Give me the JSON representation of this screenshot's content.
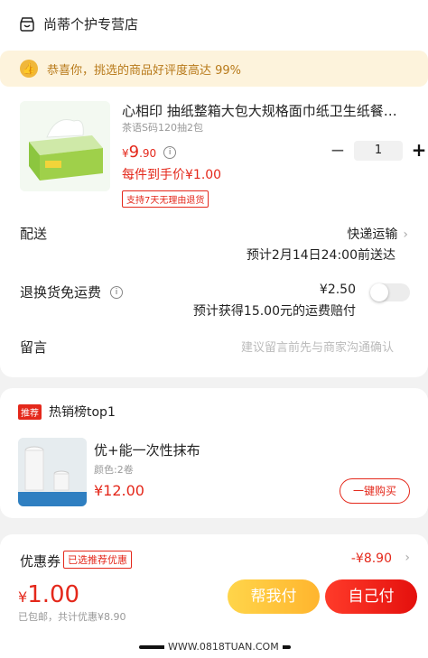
{
  "shop": {
    "name": "尚蒂个护专营店",
    "icon": "shop-icon"
  },
  "promo": {
    "text": "恭喜你，挑选的商品好评度高达 99%",
    "icon": "thumb-icon"
  },
  "product": {
    "title": "心相印 抽纸整箱大包大规格面巾纸卫生纸餐巾...",
    "spec": "茶语S码120抽2包",
    "price_symbol": "¥",
    "price_int": "9",
    "price_dec": ".90",
    "hand_price": "每件到手价¥1.00",
    "tag": "支持7天无理由退货",
    "quantity": "1",
    "minus": "−",
    "plus": "+"
  },
  "delivery": {
    "label": "配送",
    "method": "快递运输",
    "eta": "预计2月14日24:00前送达"
  },
  "return_insurance": {
    "label": "退换货免运费",
    "price": "¥2.50",
    "desc": "预计获得15.00元的运费赔付",
    "enabled": false
  },
  "message": {
    "label": "留言",
    "placeholder": "建议留言前先与商家沟通确认"
  },
  "recommend": {
    "badge": "推荐",
    "title": "热销榜top1",
    "item_title": "优+能一次性抹布",
    "item_spec": "颜色:2卷",
    "item_price": "¥12.00",
    "buy_label": "一键购买"
  },
  "coupon": {
    "label": "优惠券",
    "tag": "已选推荐优惠",
    "value": "-¥8.90"
  },
  "footer": {
    "total_symbol": "¥",
    "total_value": "1.00",
    "total_sub": "已包邮，共计优惠¥8.90",
    "help_pay": "帮我付",
    "self_pay": "自己付",
    "watermark": "WWW.0818TUAN.COM"
  },
  "colors": {
    "accent": "#e4281b",
    "promo_bg": "#fdf3dc",
    "help_btn": "#ffc43a"
  }
}
